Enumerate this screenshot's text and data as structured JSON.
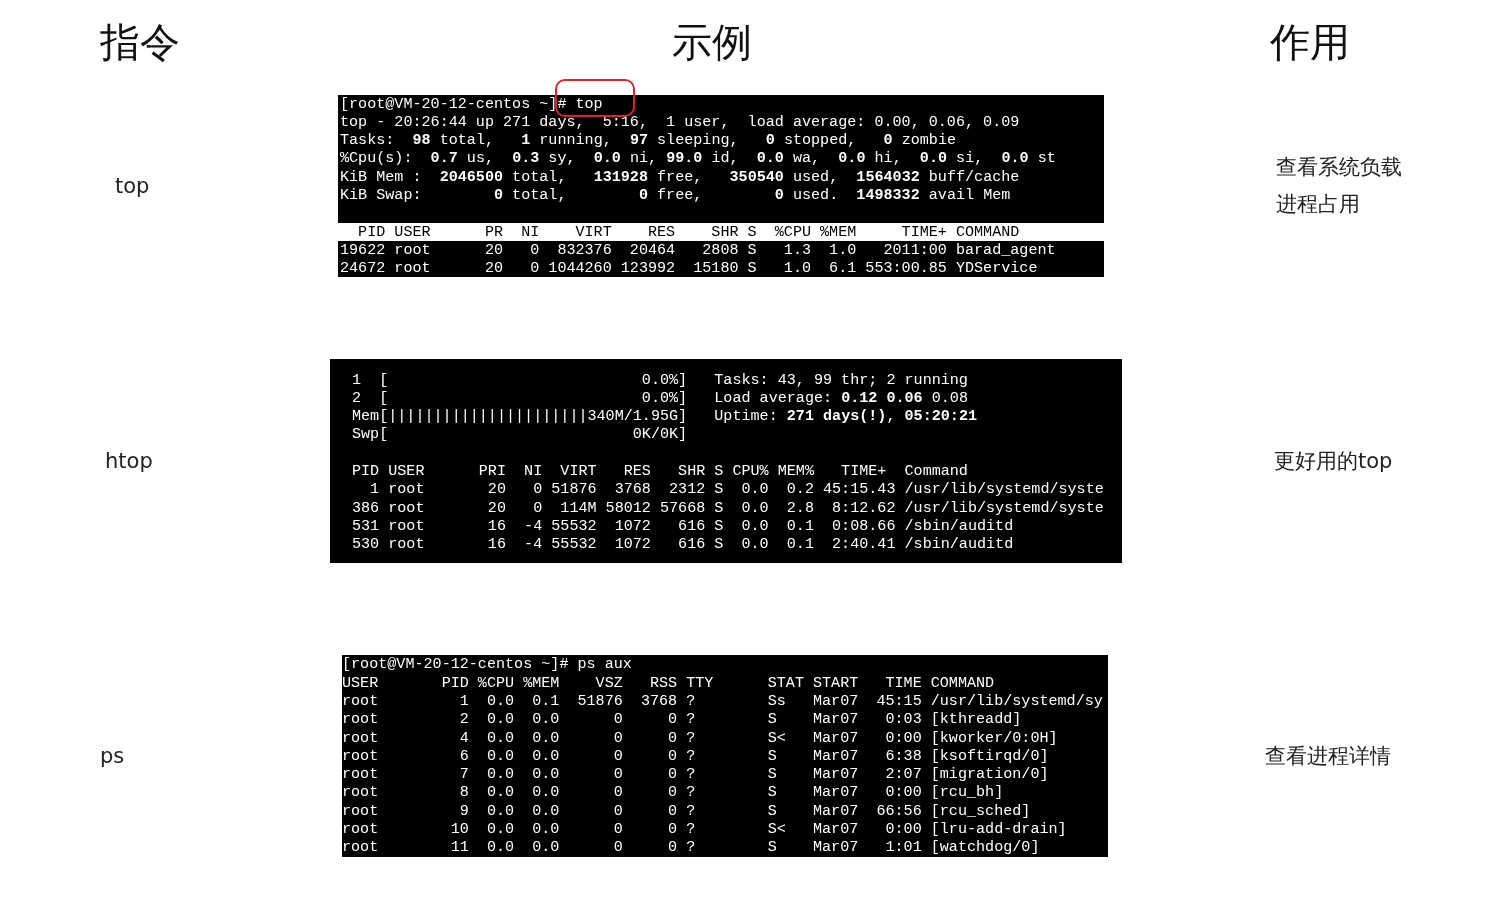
{
  "headers": [
    "指令",
    "示例",
    "作用"
  ],
  "rows": [
    {
      "command": "top",
      "purpose": "查看系统负载进程占用",
      "terminal": {
        "lines": [
          {
            "kind": "text",
            "text": "[root@VM-20-12-centos ~]# top",
            "highlighted": true
          },
          {
            "kind": "text",
            "text": "top - 20:26:44 up 271 days,  5:16,  1 user,  load average: 0.00, 0.06, 0.09",
            "highlighted": false
          },
          {
            "kind": "text",
            "text": "Tasks:  **98** total,   **1** running,  **97** sleeping,   **0** stopped,   **0** zombie",
            "highlighted": false
          },
          {
            "kind": "text",
            "text": "%Cpu(s):  **0.7** us,  **0.3** sy,  **0.0** ni, **99.0** id,  **0.0** wa,  **0.0** hi,  **0.0** si,  **0.0** st",
            "highlighted": false
          },
          {
            "kind": "text",
            "text": "KiB Mem :  **2046500** total,   **131928** free,   **350540** used,  **1564032** buff/cache",
            "highlighted": false
          },
          {
            "kind": "text",
            "text": "KiB Swap:        **0** total,        **0** free,        **0** used.  **1498332** avail Mem",
            "highlighted": false
          },
          {
            "kind": "blank"
          },
          {
            "kind": "inverse",
            "text": "  PID USER      PR  NI    VIRT    RES    SHR S  %CPU %MEM     TIME+ COMMAND",
            "highlighted": false
          },
          {
            "kind": "text",
            "text": "19622 root      20   0  832376  20464   2808 S   1.3  1.0   2011:00 barad_agent",
            "highlighted": false
          },
          {
            "kind": "text",
            "text": "24672 root      20   0 1044260 123992  15180 S   1.0  6.1 553:00.85 YDService",
            "highlighted": false
          }
        ]
      }
    },
    {
      "command": "htop",
      "purpose": "更好用的top",
      "terminal": {
        "lines": [
          {
            "kind": "text",
            "text": "1  [                            0.0%]   Tasks: 43, 99 thr; 2 running",
            "highlighted": false
          },
          {
            "kind": "text",
            "text": "2  [                            0.0%]   Load average: **0.12** **0.06** 0.08",
            "highlighted": false
          },
          {
            "kind": "text",
            "text": "Mem[||||||||||||||||||||||340M/1.95G]   Uptime: **271 days(!)**, **05:20:21**",
            "highlighted": false
          },
          {
            "kind": "text",
            "text": "Swp[                           0K/0K]",
            "highlighted": false
          },
          {
            "kind": "blank"
          },
          {
            "kind": "text",
            "text": "PID USER      PRI  NI  VIRT   RES   SHR S CPU% MEM%   TIME+  Command",
            "highlighted": false
          },
          {
            "kind": "text",
            "text": "  1 root       20   0 51876  3768  2312 S  0.0  0.2 45:15.43 /usr/lib/systemd/syste",
            "highlighted": false
          },
          {
            "kind": "text",
            "text": "386 root       20   0  114M 58012 57668 S  0.0  2.8  8:12.62 /usr/lib/systemd/syste",
            "highlighted": false
          },
          {
            "kind": "text",
            "text": "531 root       16  -4 55532  1072   616 S  0.0  0.1  0:08.66 /sbin/auditd",
            "highlighted": false
          },
          {
            "kind": "text",
            "text": "530 root       16  -4 55532  1072   616 S  0.0  0.1  2:40.41 /sbin/auditd",
            "highlighted": false
          }
        ]
      }
    },
    {
      "command": "ps",
      "purpose": "查看进程详情",
      "terminal": {
        "lines": [
          {
            "kind": "text",
            "text": "[root@VM-20-12-centos ~]# ps aux",
            "highlighted": false
          },
          {
            "kind": "text",
            "text": "USER       PID %CPU %MEM    VSZ   RSS TTY      STAT START   TIME COMMAND",
            "highlighted": false
          },
          {
            "kind": "text",
            "text": "root         1  0.0  0.1  51876  3768 ?        Ss   Mar07  45:15 /usr/lib/systemd/sy",
            "highlighted": false
          },
          {
            "kind": "text",
            "text": "root         2  0.0  0.0      0     0 ?        S    Mar07   0:03 [kthreadd]",
            "highlighted": false
          },
          {
            "kind": "text",
            "text": "root         4  0.0  0.0      0     0 ?        S<   Mar07   0:00 [kworker/0:0H]",
            "highlighted": false
          },
          {
            "kind": "text",
            "text": "root         6  0.0  0.0      0     0 ?        S    Mar07   6:38 [ksoftirqd/0]",
            "highlighted": false
          },
          {
            "kind": "text",
            "text": "root         7  0.0  0.0      0     0 ?        S    Mar07   2:07 [migration/0]",
            "highlighted": false
          },
          {
            "kind": "text",
            "text": "root         8  0.0  0.0      0     0 ?        S    Mar07   0:00 [rcu_bh]",
            "highlighted": false
          },
          {
            "kind": "text",
            "text": "root         9  0.0  0.0      0     0 ?        S    Mar07  66:56 [rcu_sched]",
            "highlighted": false
          },
          {
            "kind": "text",
            "text": "root        10  0.0  0.0      0     0 ?        S<   Mar07   0:00 [lru-add-drain]",
            "highlighted": false
          },
          {
            "kind": "text",
            "text": "root        11  0.0  0.0      0     0 ?        S    Mar07   1:01 [watchdog/0]",
            "highlighted": false
          }
        ]
      }
    }
  ]
}
